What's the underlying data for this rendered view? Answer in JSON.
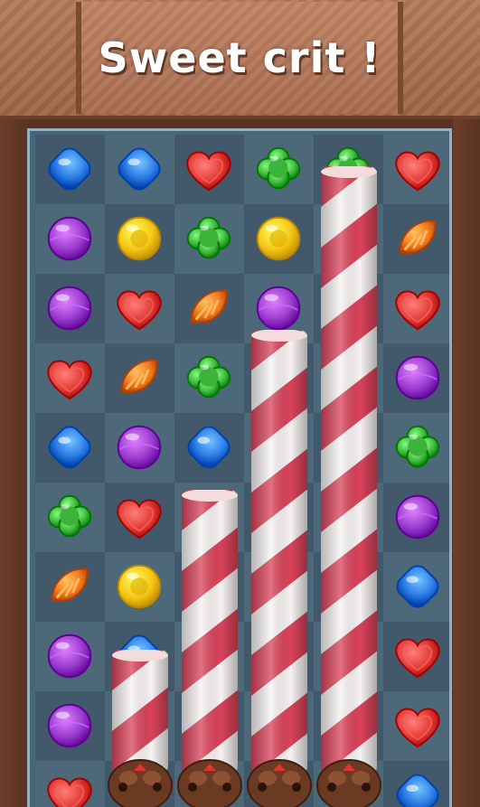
{
  "banner": {
    "title": "Sweet crit !"
  },
  "board": {
    "cols": 6,
    "grid": [
      [
        "blue",
        "blue",
        "red",
        "green",
        "green",
        "red"
      ],
      [
        "purple",
        "yellow",
        "green",
        "yellow",
        "",
        "orange"
      ],
      [
        "purple",
        "red",
        "orange",
        "purple",
        "",
        "red"
      ],
      [
        "red",
        "orange",
        "green",
        "",
        "",
        "purple"
      ],
      [
        "blue",
        "purple",
        "blue",
        "",
        "",
        "green"
      ],
      [
        "green",
        "red",
        "",
        "",
        "",
        "purple"
      ],
      [
        "orange",
        "yellow",
        "",
        "",
        "",
        "blue"
      ],
      [
        "purple",
        "blue",
        "",
        "",
        "",
        "red"
      ],
      [
        "purple",
        "",
        "",
        "",
        "",
        "red"
      ],
      [
        "red",
        "",
        "",
        "",
        "",
        "blue"
      ]
    ],
    "striped_candies": [
      {
        "col": 1,
        "top_row": 7.4
      },
      {
        "col": 2,
        "top_row": 5.1
      },
      {
        "col": 3,
        "top_row": 2.8
      },
      {
        "col": 4,
        "top_row": 0.45
      }
    ],
    "chocolates": [
      1,
      2,
      3,
      4
    ]
  },
  "colors": {
    "red": "#e03a35",
    "blue": "#2e7ee8",
    "green": "#3cb43a",
    "purple": "#9a3bcf",
    "yellow": "#f5c415",
    "orange": "#f07b1e"
  },
  "candy_shapes": {
    "red": "heart-icon",
    "blue": "rounded-square-icon",
    "green": "clover-icon",
    "purple": "lollipop-icon",
    "yellow": "round-drop-icon",
    "orange": "orange-slice-icon"
  }
}
